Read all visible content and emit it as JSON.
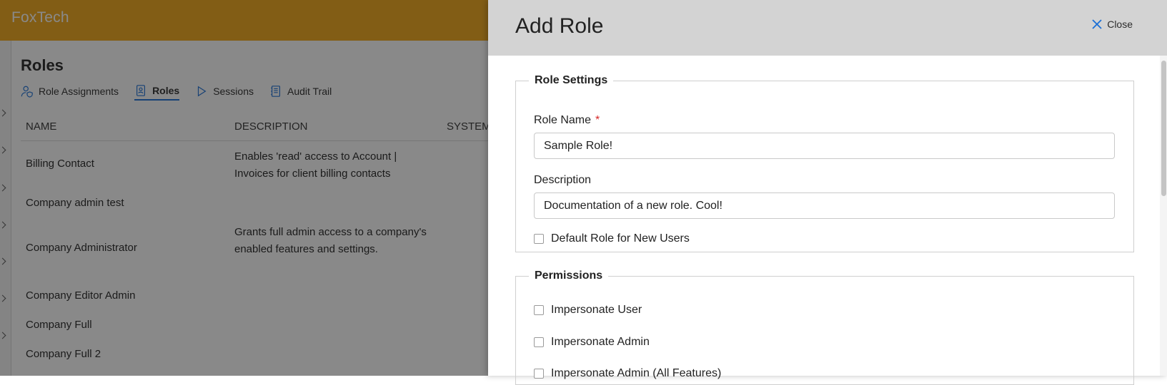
{
  "app": {
    "brand": "FoxTech",
    "page_title": "Roles"
  },
  "tabs": [
    {
      "label": "Role Assignments",
      "icon": "user-shield-icon"
    },
    {
      "label": "Roles",
      "icon": "id-badge-icon",
      "active": true
    },
    {
      "label": "Sessions",
      "icon": "play-icon"
    },
    {
      "label": "Audit Trail",
      "icon": "notebook-icon"
    }
  ],
  "table": {
    "columns": [
      "NAME",
      "DESCRIPTION",
      "SYSTEM"
    ],
    "rows": [
      {
        "name": "Billing Contact",
        "description": "Enables 'read' access to Account | Invoices for client billing contacts"
      },
      {
        "name": "Company admin test",
        "description": ""
      },
      {
        "name": "Company Administrator",
        "description": "Grants full admin access to a company's enabled features and settings."
      },
      {
        "name": "Company Editor Admin",
        "description": ""
      },
      {
        "name": "Company Full",
        "description": ""
      },
      {
        "name": "Company Full 2",
        "description": ""
      }
    ]
  },
  "panel": {
    "title": "Add Role",
    "close_label": "Close",
    "role_settings": {
      "legend": "Role Settings",
      "role_name_label": "Role Name",
      "required_mark": "*",
      "role_name_value": "Sample Role!",
      "description_label": "Description",
      "description_value": "Documentation of a new role. Cool!",
      "default_role_label": "Default Role for New Users"
    },
    "permissions": {
      "legend": "Permissions",
      "items": [
        "Impersonate User",
        "Impersonate Admin",
        "Impersonate Admin (All Features)"
      ]
    }
  },
  "colors": {
    "topbar": "#f0a616",
    "accent": "#1a6fd6",
    "required": "#d62828",
    "system_check": "#2f9a3a"
  }
}
